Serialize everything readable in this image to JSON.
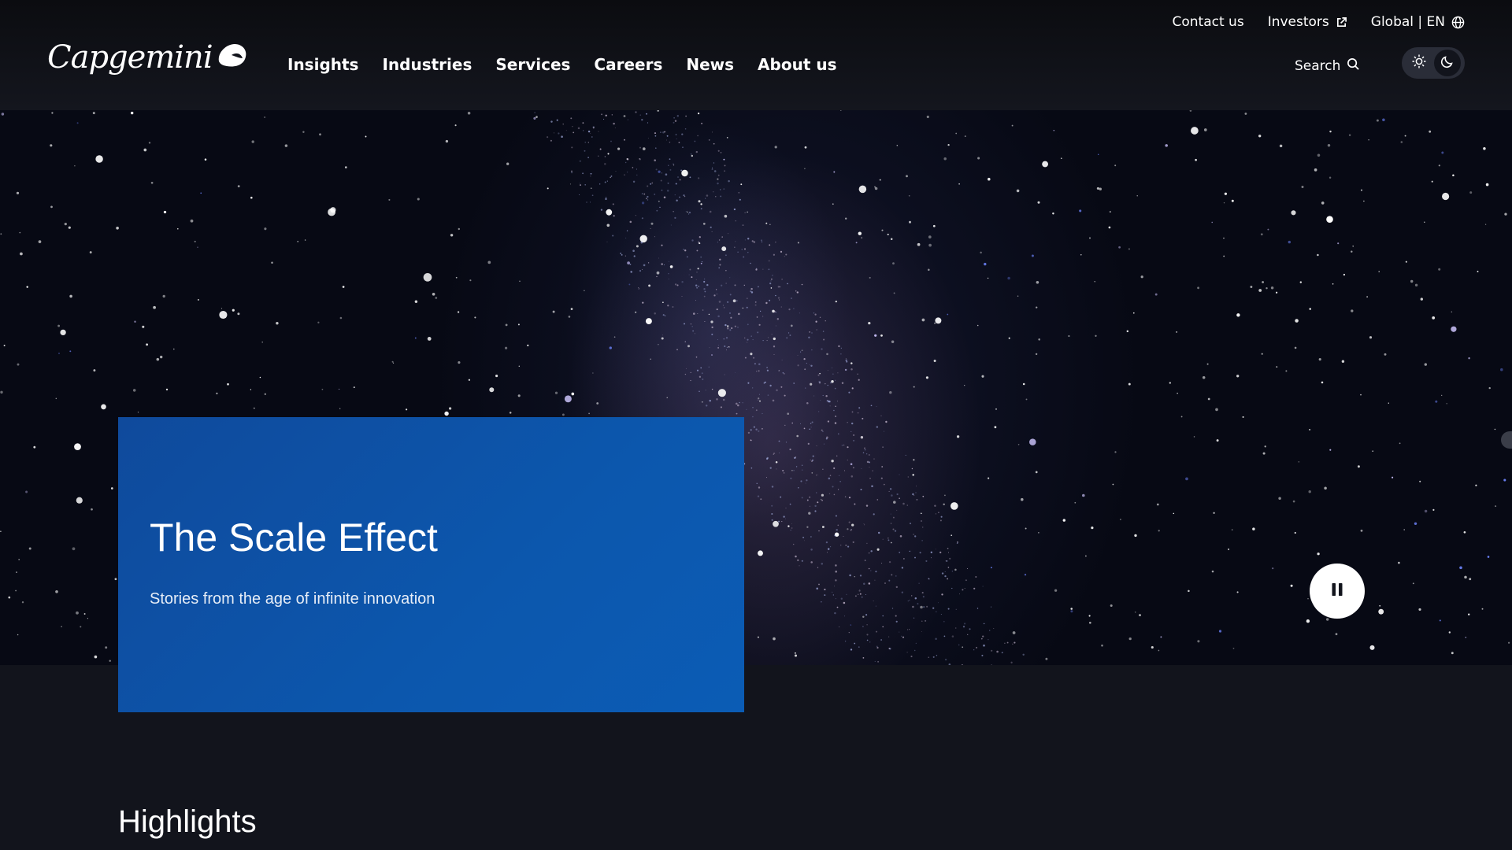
{
  "header": {
    "utility_links": {
      "contact": "Contact us",
      "investors": "Investors",
      "region": "Global | EN"
    },
    "logo_text": "Capgemini",
    "nav": {
      "insights": "Insights",
      "industries": "Industries",
      "services": "Services",
      "careers": "Careers",
      "news": "News",
      "about": "About us"
    },
    "search_label": "Search",
    "theme_toggle": {
      "options": [
        "light",
        "dark"
      ],
      "selected": "dark"
    }
  },
  "hero": {
    "title": "The Scale Effect",
    "subtitle": "Stories from the age of infinite innovation",
    "playback_icon": "pause-icon"
  },
  "highlights": {
    "title": "Highlights"
  },
  "colors": {
    "card_blue": "#0c57ad",
    "page_bg": "#12141c",
    "header_bg": "#0b0c10"
  }
}
